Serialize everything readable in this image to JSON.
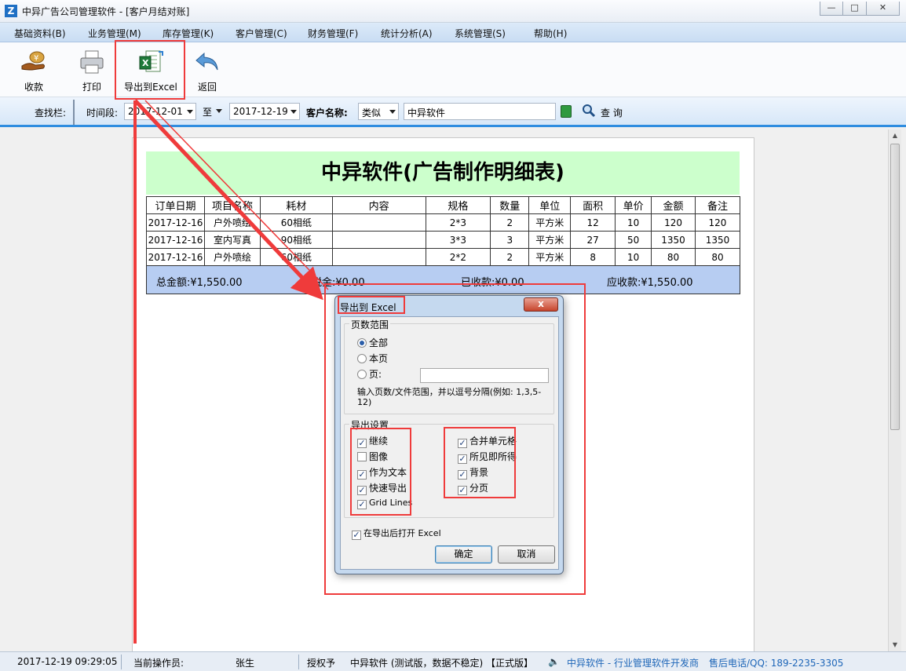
{
  "window": {
    "title": "中异广告公司管理软件 - [客户月结对账]",
    "logo_letter": "Z",
    "controls": {
      "minimize": "—",
      "maximize": "□",
      "close": "✕"
    }
  },
  "menu": [
    "基础资料(B)",
    "业务管理(M)",
    "库存管理(K)",
    "客户管理(C)",
    "财务管理(F)",
    "统计分析(A)",
    "系统管理(S)",
    "帮助(H)"
  ],
  "toolbar": {
    "receive_label": "收款",
    "print_label": "打印",
    "export_label": "导出到Excel",
    "back_label": "返回"
  },
  "search": {
    "bar_label": "查找栏:",
    "period_label": "时间段:",
    "date_from": "2017-12-01",
    "to_label": "至",
    "date_to": "2017-12-19",
    "customer_label": "客户名称:",
    "match_mode": "类似",
    "customer_value": "中异软件",
    "query_label": "查 询"
  },
  "report": {
    "title": "中异软件(广告制作明细表)",
    "columns": [
      "订单日期",
      "项目名称",
      "耗材",
      "内容",
      "规格",
      "数量",
      "单位",
      "面积",
      "单价",
      "金额",
      "备注"
    ],
    "rows": [
      [
        "2017-12-16",
        "户外喷绘",
        "60相纸",
        "",
        "2*3",
        "2",
        "平方米",
        "12",
        "10",
        "120",
        "120"
      ],
      [
        "2017-12-16",
        "室内写真",
        "90相纸",
        "",
        "3*3",
        "3",
        "平方米",
        "27",
        "50",
        "1350",
        "1350"
      ],
      [
        "2017-12-16",
        "户外喷绘",
        "60相纸",
        "",
        "2*2",
        "2",
        "平方米",
        "8",
        "10",
        "80",
        "80"
      ]
    ],
    "totals": {
      "total": "总金额:¥1,550.00",
      "tax": "税金:¥0.00",
      "received": "已收款:¥0.00",
      "receivable": "应收款:¥1,550.00"
    },
    "title_bg": "#ccffcc",
    "totals_bg": "#b7cdf2"
  },
  "dialog": {
    "title": "导出到 Excel",
    "close": "x",
    "range_group": "页数范围",
    "range_all": "全部",
    "range_current": "本页",
    "range_pages": "页:",
    "range_hint": "输入页数/文件范围，并以逗号分隔(例如: 1,3,5-12)",
    "settings_group": "导出设置",
    "left_options": [
      "继续",
      "图像",
      "作为文本",
      "快速导出",
      "Grid Lines"
    ],
    "left_checked": [
      true,
      false,
      true,
      true,
      true
    ],
    "right_options": [
      "合并单元格",
      "所见即所得",
      "背景",
      "分页"
    ],
    "right_checked": [
      true,
      true,
      true,
      true
    ],
    "open_after": "在导出后打开 Excel",
    "ok": "确定",
    "cancel": "取消"
  },
  "status": {
    "datetime": "2017-12-19 09:29:05",
    "operator_label": "当前操作员:",
    "operator": "张生",
    "license": "授权予",
    "product": "中异软件 (测试版，数据不稳定) 【正式版】",
    "vendor": "中异软件 - 行业管理软件开发商",
    "hotline": "售后电话/QQ: 189-2235-3305"
  },
  "annotation_color": "#ef3b3b"
}
